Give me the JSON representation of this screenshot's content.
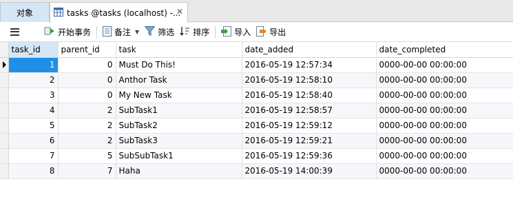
{
  "tabs": {
    "objects_label": "对象",
    "query_label": "tasks @tasks (localhost) -...",
    "close_glyph": "✕"
  },
  "toolbar": {
    "begin_transaction": "开始事务",
    "notes": "备注",
    "filter": "筛选",
    "sort": "排序",
    "import": "导入",
    "export": "导出"
  },
  "grid": {
    "columns": [
      "task_id",
      "parent_id",
      "task",
      "date_added",
      "date_completed"
    ],
    "rows": [
      [
        "1",
        "0",
        "Must Do This!",
        "2016-05-19 12:57:34",
        "0000-00-00 00:00:00"
      ],
      [
        "2",
        "0",
        "Anthor Task",
        "2016-05-19 12:58:10",
        "0000-00-00 00:00:00"
      ],
      [
        "3",
        "0",
        "My New Task",
        "2016-05-19 12:58:40",
        "0000-00-00 00:00:00"
      ],
      [
        "4",
        "2",
        "SubTask1",
        "2016-05-19 12:58:57",
        "0000-00-00 00:00:00"
      ],
      [
        "5",
        "2",
        "SubTask2",
        "2016-05-19 12:59:12",
        "0000-00-00 00:00:00"
      ],
      [
        "6",
        "2",
        "SubTask3",
        "2016-05-19 12:59:21",
        "0000-00-00 00:00:00"
      ],
      [
        "7",
        "5",
        "SubSubTask1",
        "2016-05-19 12:59:36",
        "0000-00-00 00:00:00"
      ],
      [
        "8",
        "7",
        "Haha",
        "2016-05-19 14:00:39",
        "0000-00-00 00:00:00"
      ]
    ]
  },
  "colors": {
    "selection": "#1f90e8",
    "tab_active": "#d7e6f5"
  }
}
